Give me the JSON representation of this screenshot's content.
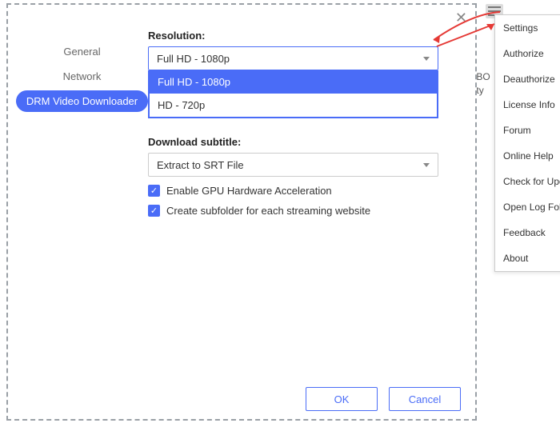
{
  "dialog": {
    "close": "✕",
    "sidebar": {
      "items": [
        {
          "label": "General"
        },
        {
          "label": "Network"
        },
        {
          "label": "DRM Video Downloader"
        }
      ]
    },
    "resolution": {
      "label": "Resolution:",
      "selected": "Full HD - 1080p",
      "options": [
        "Full HD - 1080p",
        "HD - 720p"
      ]
    },
    "subtitle": {
      "label": "Download subtitle:",
      "selected": "Extract to SRT File"
    },
    "checks": {
      "gpu": "Enable GPU Hardware Acceleration",
      "subfolder": "Create subfolder for each streaming website"
    },
    "buttons": {
      "ok": "OK",
      "cancel": "Cancel"
    }
  },
  "menu": {
    "items": [
      "Settings",
      "Authorize",
      "Deauthorize",
      "License Info",
      "Forum",
      "Online Help",
      "Check for Updates",
      "Open Log Folder",
      "Feedback",
      "About"
    ]
  },
  "bg": {
    "line1": "deo, HBO",
    "line2": "o quality"
  }
}
